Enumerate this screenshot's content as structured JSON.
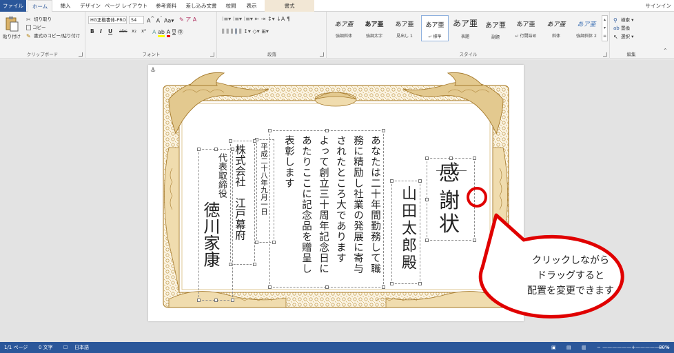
{
  "tabs": {
    "file": "ファイル",
    "home": "ホーム",
    "insert": "挿入",
    "design": "デザイン",
    "layout": "ページ レイアウト",
    "references": "参考資料",
    "mailings": "差し込み文書",
    "review": "校閲",
    "view": "表示",
    "format": "書式"
  },
  "signin": "サインイン",
  "clipboard": {
    "paste": "貼り付け",
    "cut": "切り取り",
    "copy": "コピー",
    "format_painter": "書式のコピー/貼り付け",
    "label": "クリップボード"
  },
  "font": {
    "name": "HG正楷書体-PRO",
    "size": "54",
    "label": "フォント",
    "bold": "B",
    "italic": "I",
    "underline": "U",
    "strike": "abc",
    "sub": "x₂",
    "sup": "x²"
  },
  "paragraph": {
    "label": "段落"
  },
  "styles": {
    "label": "スタイル",
    "items": [
      {
        "sample": "あア亜",
        "name": "強調斜体"
      },
      {
        "sample": "あア亜",
        "name": "強調太字"
      },
      {
        "sample": "あア亜",
        "name": "見出し 1"
      },
      {
        "sample": "あア亜",
        "name": "↵ 標準"
      },
      {
        "sample": "あア亜",
        "name": "表題"
      },
      {
        "sample": "あア亜",
        "name": "副題"
      },
      {
        "sample": "あア亜",
        "name": "↵ 行間詰め"
      },
      {
        "sample": "あア亜",
        "name": "斜体"
      },
      {
        "sample": "あア亜",
        "name": "強調斜体 2"
      }
    ]
  },
  "editing": {
    "find": "検索",
    "replace": "置換",
    "select": "選択",
    "label": "編集"
  },
  "document": {
    "title_chars": [
      "感",
      "謝",
      "状"
    ],
    "recipient": "山田太郎殿",
    "body_columns": [
      "あなたは二十年間勤務して職",
      "務に精励し社業の発展に寄与",
      "されたところ大であります",
      "よって創立三十周年記念日に",
      "あたりここに記念品を贈呈し",
      "表彰します"
    ],
    "date": "平成二十八年九月一日",
    "company": "株式会社　江戸幕府",
    "signer_title": "代表取締役",
    "signer_name": "徳川家康"
  },
  "callout": {
    "lines": [
      "クリックしながら",
      "ドラッグすると",
      "配置を変更できます"
    ],
    "color": "#e00000"
  },
  "status": {
    "page": "1/1 ページ",
    "words": "0 文字",
    "lang": "日本語",
    "zoom": "80%"
  },
  "colors": {
    "accent": "#2b579a",
    "frame": "#c9a55c"
  }
}
